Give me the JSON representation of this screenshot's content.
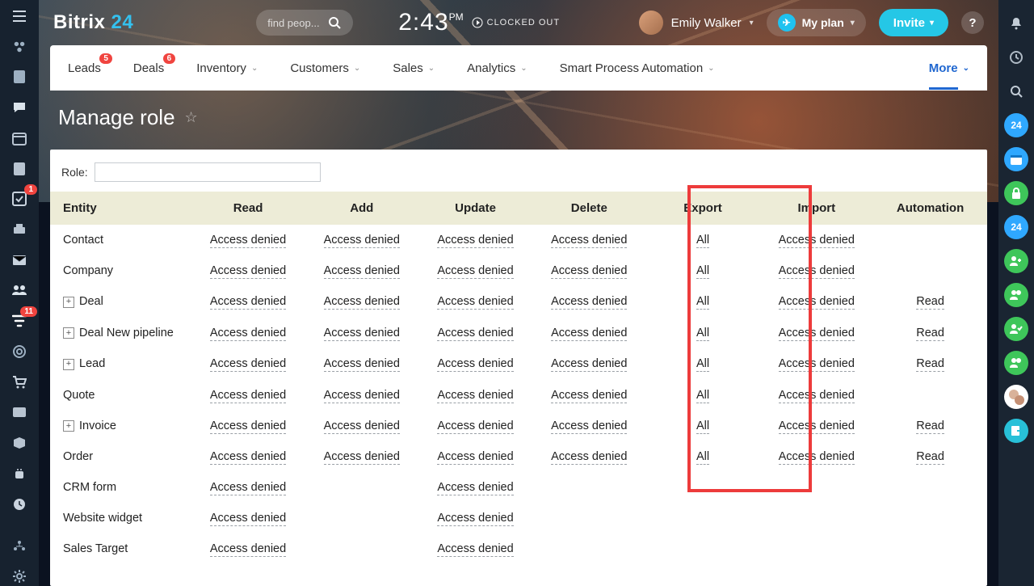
{
  "brand": {
    "part1": "Bitrix",
    "part2": "24"
  },
  "search": {
    "placeholder": "find peop..."
  },
  "clock": {
    "time": "2:43",
    "ampm": "PM",
    "status": "CLOCKED OUT"
  },
  "user": {
    "name": "Emily Walker"
  },
  "myplan": {
    "label": "My plan"
  },
  "invite": {
    "label": "Invite"
  },
  "left_badges": {
    "tasks": "1",
    "filter": "11"
  },
  "nav": {
    "leads": {
      "label": "Leads",
      "badge": "5"
    },
    "deals": {
      "label": "Deals",
      "badge": "6"
    },
    "inventory": "Inventory",
    "customers": "Customers",
    "sales": "Sales",
    "analytics": "Analytics",
    "spa": "Smart Process Automation",
    "more": "More"
  },
  "page": {
    "title": "Manage role"
  },
  "role_label": "Role:",
  "columns": [
    "Entity",
    "Read",
    "Add",
    "Update",
    "Delete",
    "Export",
    "Import",
    "Automation"
  ],
  "vals": {
    "denied": "Access denied",
    "all": "All",
    "read": "Read"
  },
  "rows": [
    {
      "entity": "Contact",
      "exp": false,
      "r": "denied",
      "a": "denied",
      "u": "denied",
      "d": "denied",
      "e": "all",
      "i": "denied",
      "au": ""
    },
    {
      "entity": "Company",
      "exp": false,
      "r": "denied",
      "a": "denied",
      "u": "denied",
      "d": "denied",
      "e": "all",
      "i": "denied",
      "au": ""
    },
    {
      "entity": "Deal",
      "exp": true,
      "r": "denied",
      "a": "denied",
      "u": "denied",
      "d": "denied",
      "e": "all",
      "i": "denied",
      "au": "read"
    },
    {
      "entity": "Deal New pipeline",
      "exp": true,
      "r": "denied",
      "a": "denied",
      "u": "denied",
      "d": "denied",
      "e": "all",
      "i": "denied",
      "au": "read"
    },
    {
      "entity": "Lead",
      "exp": true,
      "r": "denied",
      "a": "denied",
      "u": "denied",
      "d": "denied",
      "e": "all",
      "i": "denied",
      "au": "read"
    },
    {
      "entity": "Quote",
      "exp": false,
      "r": "denied",
      "a": "denied",
      "u": "denied",
      "d": "denied",
      "e": "all",
      "i": "denied",
      "au": ""
    },
    {
      "entity": "Invoice",
      "exp": true,
      "r": "denied",
      "a": "denied",
      "u": "denied",
      "d": "denied",
      "e": "all",
      "i": "denied",
      "au": "read"
    },
    {
      "entity": "Order",
      "exp": false,
      "r": "denied",
      "a": "denied",
      "u": "denied",
      "d": "denied",
      "e": "all",
      "i": "denied",
      "au": "read"
    },
    {
      "entity": "CRM form",
      "exp": false,
      "r": "denied",
      "a": "",
      "u": "denied",
      "d": "",
      "e": "",
      "i": "",
      "au": ""
    },
    {
      "entity": "Website widget",
      "exp": false,
      "r": "denied",
      "a": "",
      "u": "denied",
      "d": "",
      "e": "",
      "i": "",
      "au": ""
    },
    {
      "entity": "Sales Target",
      "exp": false,
      "r": "denied",
      "a": "",
      "u": "denied",
      "d": "",
      "e": "",
      "i": "",
      "au": ""
    }
  ]
}
